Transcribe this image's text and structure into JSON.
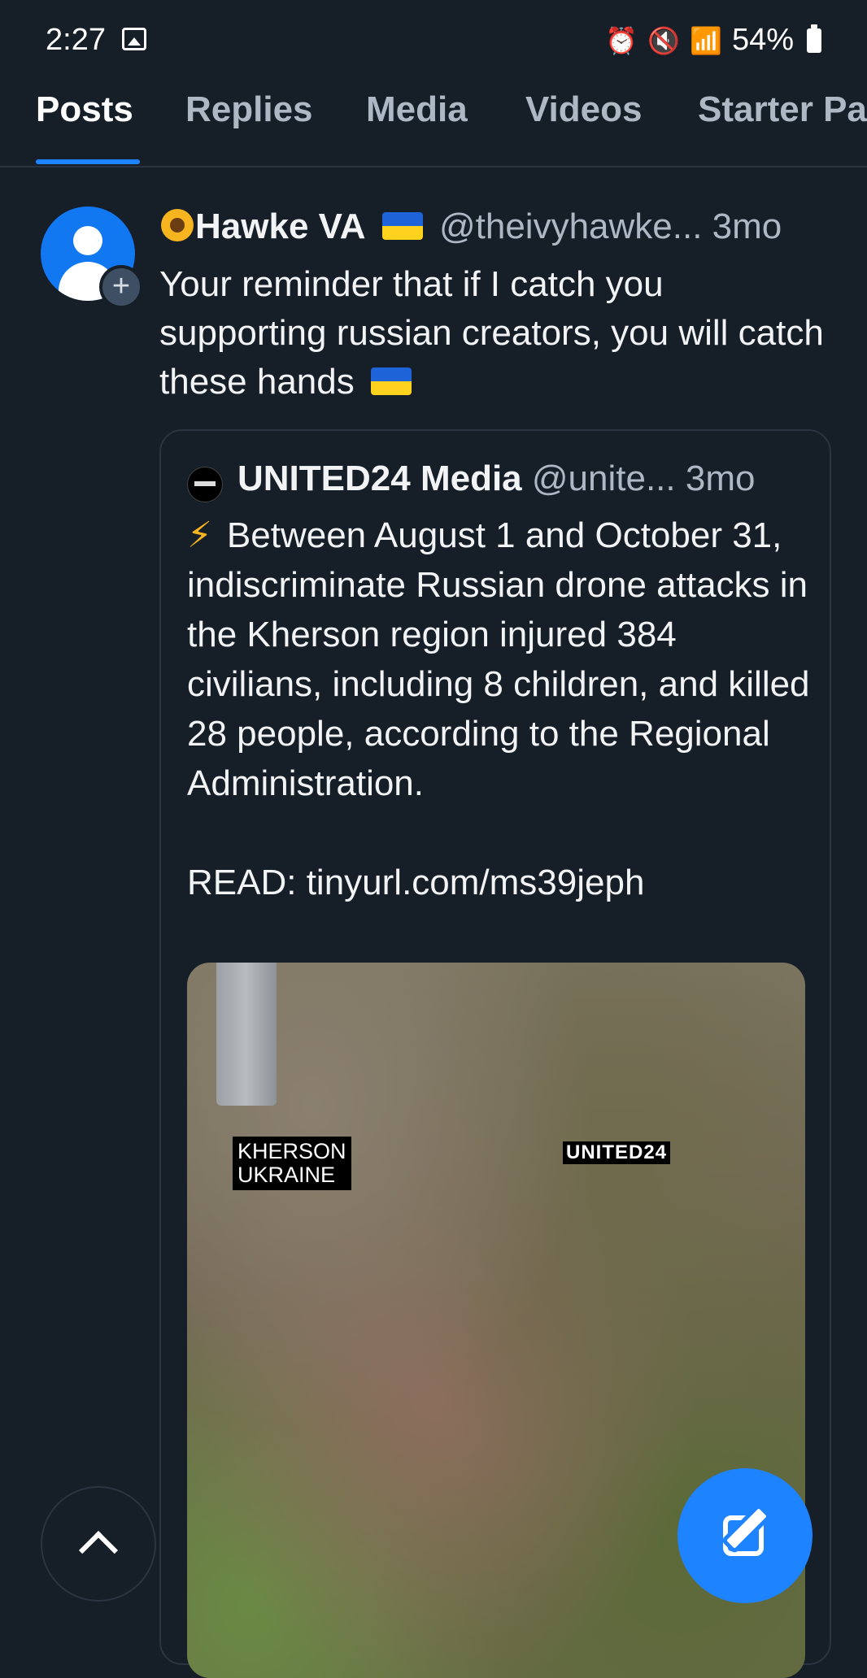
{
  "status_bar": {
    "time": "2:27",
    "battery": "54%"
  },
  "tabs": [
    {
      "label": "Posts",
      "active": true
    },
    {
      "label": "Replies",
      "active": false
    },
    {
      "label": "Media",
      "active": false
    },
    {
      "label": "Videos",
      "active": false
    },
    {
      "label": "Starter Pa",
      "active": false
    }
  ],
  "post": {
    "author": "Hawke VA",
    "handle": "@theivyhawke...",
    "age": "3mo",
    "text": "Your reminder that if I catch you supporting russian creators, you will catch these hands",
    "quote": {
      "author": "UNITED24 Media",
      "handle": "@unite...",
      "age": "3mo",
      "text": "Between August 1 and October 31, indiscriminate Russian drone attacks in the Kherson region injured 384 civilians, including 8 children, and killed 28 people, according to the Regional Administration.",
      "read_link": "READ: tinyurl.com/ms39jeph",
      "media": {
        "label_line1": "KHERSON",
        "label_line2": "UKRAINE",
        "watermark": "UNITED24"
      }
    }
  },
  "colors": {
    "background": "#161e27",
    "accent": "#1d83ff",
    "muted_text": "#aeb8c4"
  }
}
